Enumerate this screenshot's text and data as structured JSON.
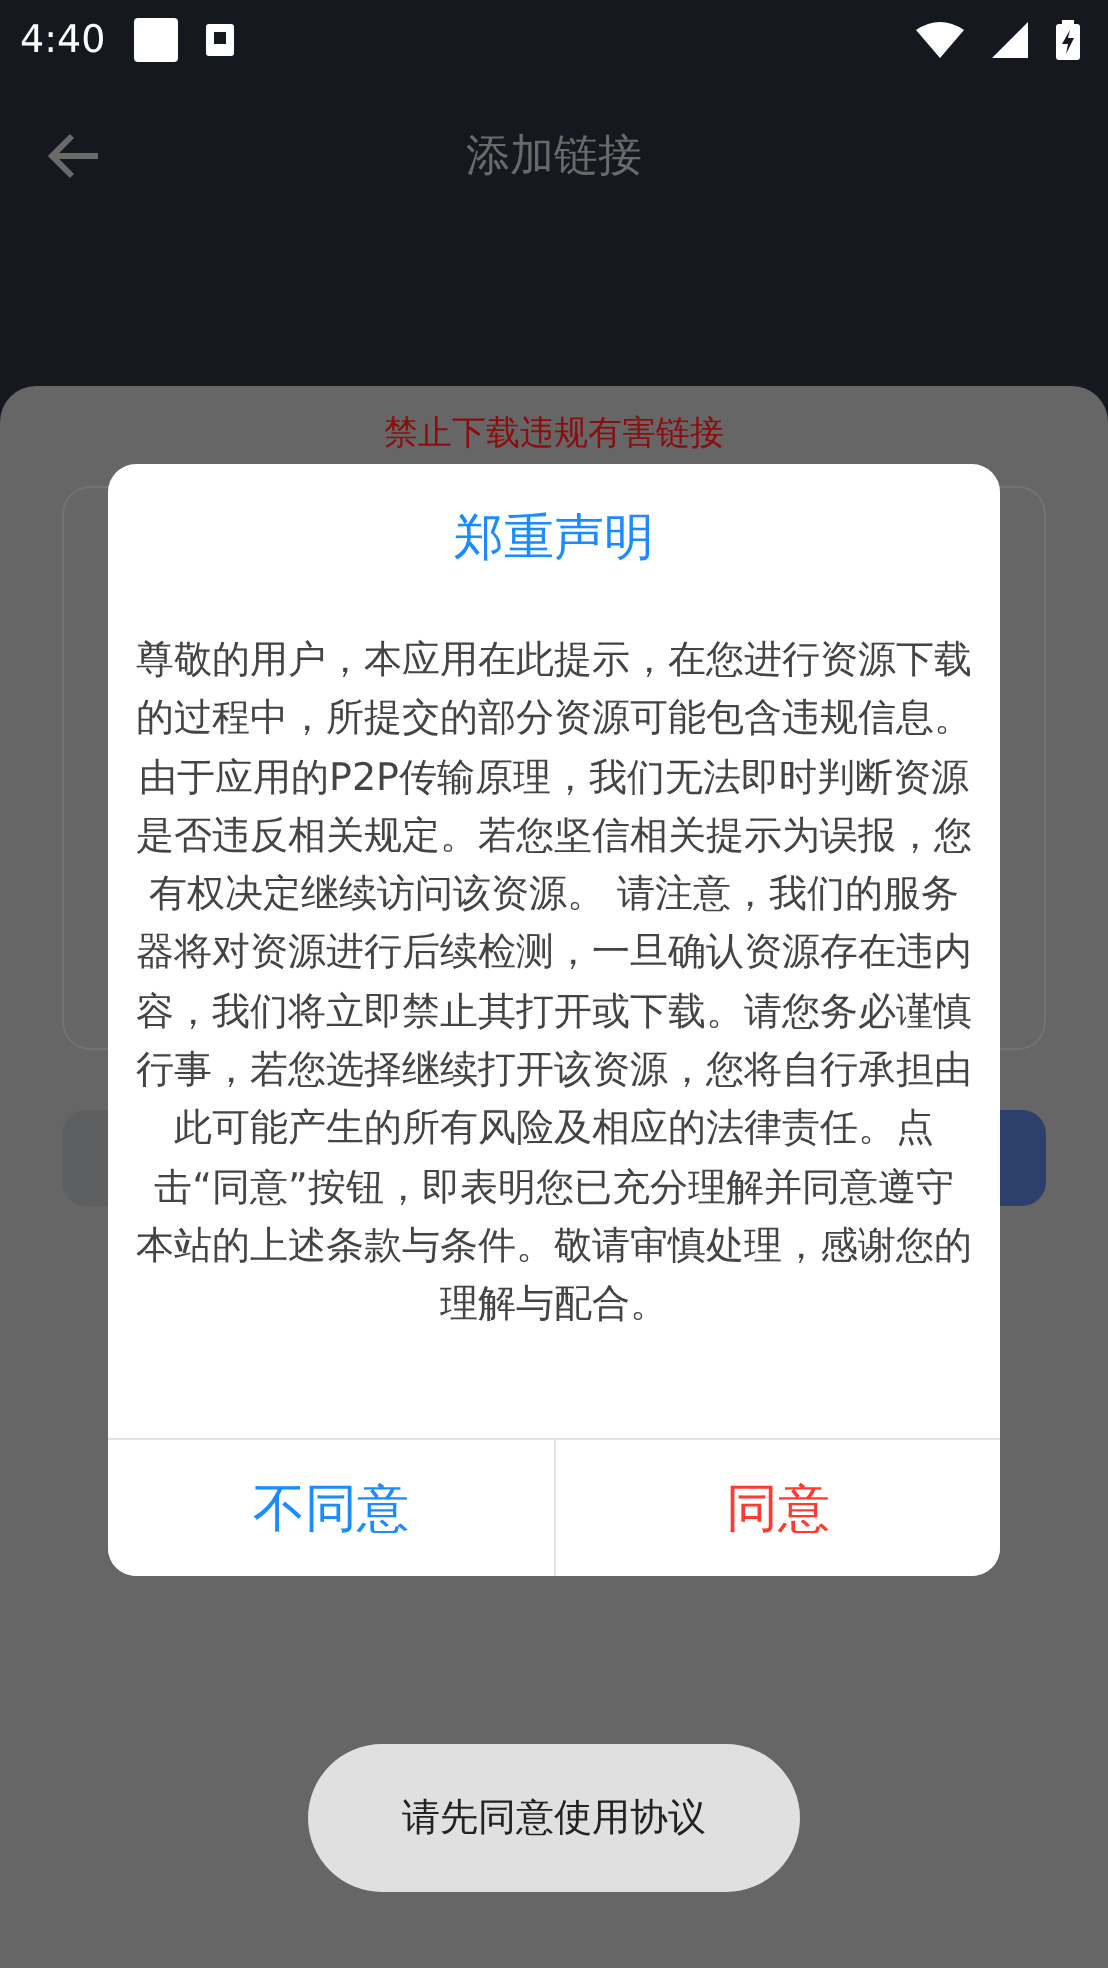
{
  "status_bar": {
    "time": "4:40"
  },
  "header": {
    "title": "添加链接"
  },
  "sheet": {
    "warning": "禁止下载违规有害链接"
  },
  "dialog": {
    "title": "郑重声明",
    "body": "尊敬的用户，本应用在此提示，在您进行资源下载的过程中，所提交的部分资源可能包含违规信息。由于应用的P2P传输原理，我们无法即时判断资源是否违反相关规定。若您坚信相关提示为误报，您有权决定继续访问该资源。 请注意，我们的服务器将对资源进行后续检测，一旦确认资源存在违内容，我们将立即禁止其打开或下载。请您务必谨慎行事，若您选择继续打开该资源，您将自行承担由此可能产生的所有风险及相应的法律责任。点击“同意”按钮，即表明您已充分理解并同意遵守本站的上述条款与条件。敬请审慎处理，感谢您的理解与配合。",
    "buttons": [
      {
        "label": "不同意",
        "kind": "decline"
      },
      {
        "label": "同意",
        "kind": "accept"
      }
    ]
  },
  "toast": {
    "text": "请先同意使用协议"
  }
}
